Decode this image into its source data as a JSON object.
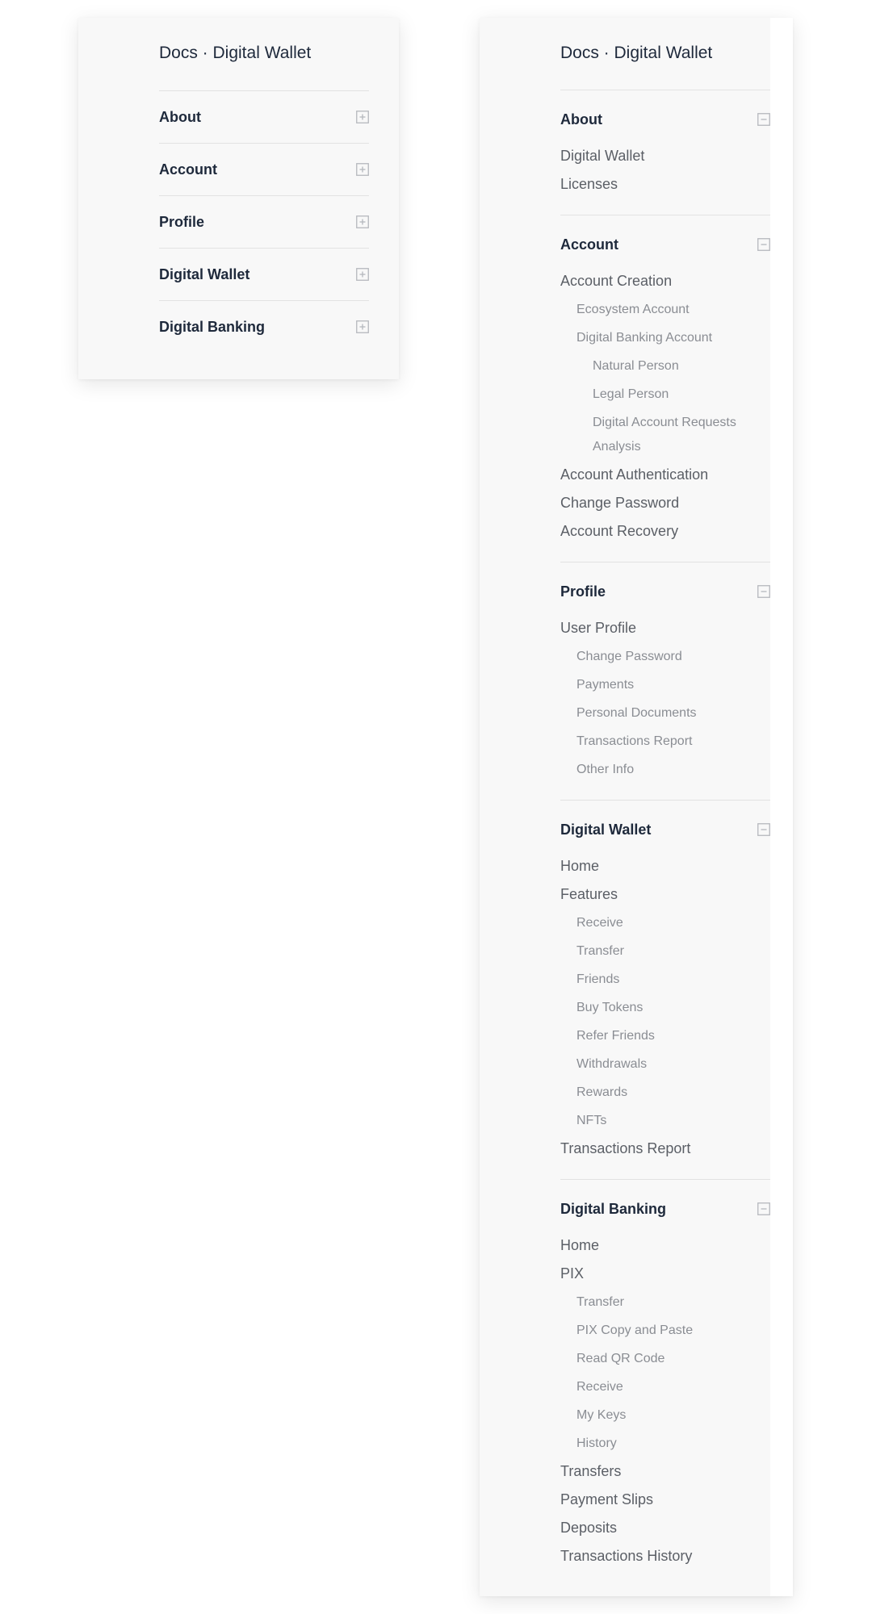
{
  "site_title": "Docs · Digital Wallet",
  "collapsed_menu": {
    "sections": [
      {
        "label": "About"
      },
      {
        "label": "Account"
      },
      {
        "label": "Profile"
      },
      {
        "label": "Digital Wallet"
      },
      {
        "label": "Digital Banking"
      }
    ]
  },
  "expanded_menu": {
    "about": {
      "label": "About",
      "items": [
        "Digital Wallet",
        "Licenses"
      ]
    },
    "account": {
      "label": "Account",
      "account_creation": "Account Creation",
      "ecosystem_account": "Ecosystem Account",
      "digital_banking_account": "Digital Banking Account",
      "natural_person": "Natural Person",
      "legal_person": "Legal Person",
      "digital_account_requests_analysis": "Digital Account Requests Analysis",
      "account_authentication": "Account Authentication",
      "change_password": "Change Password",
      "account_recovery": "Account Recovery"
    },
    "profile": {
      "label": "Profile",
      "user_profile": "User Profile",
      "subitems": [
        "Change Password",
        "Payments",
        "Personal Documents",
        "Transactions Report",
        "Other Info"
      ]
    },
    "digital_wallet": {
      "label": "Digital Wallet",
      "home": "Home",
      "features": "Features",
      "feature_items": [
        "Receive",
        "Transfer",
        "Friends",
        "Buy Tokens",
        "Refer Friends",
        "Withdrawals",
        "Rewards",
        "NFTs"
      ],
      "transactions_report": "Transactions Report"
    },
    "digital_banking": {
      "label": "Digital Banking",
      "home": "Home",
      "pix": "PIX",
      "pix_items": [
        "Transfer",
        "PIX Copy and Paste",
        "Read QR Code",
        "Receive",
        "My Keys",
        "History"
      ],
      "after_items": [
        "Transfers",
        "Payment Slips",
        "Deposits",
        "Transactions History"
      ]
    }
  },
  "colors": {
    "panel_bg": "#f8f8f8",
    "heading": "#1e293b",
    "item_level1": "#5b5f66",
    "item_level2": "#8a8d93",
    "divider": "#e2e2e2",
    "icon": "#b5b8bd"
  },
  "icons": {
    "collapsed_toggle": "plus-square-icon",
    "expanded_toggle": "minus-square-icon"
  }
}
